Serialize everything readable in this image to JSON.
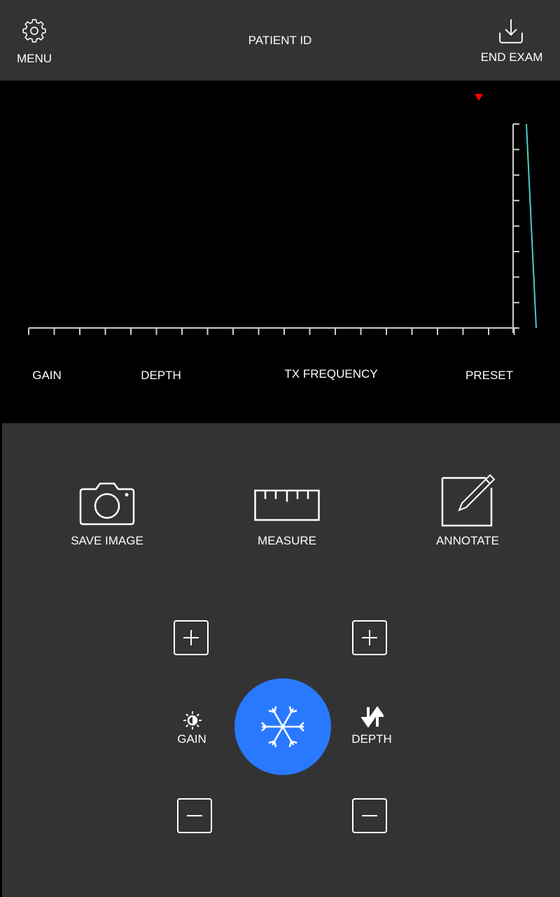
{
  "header": {
    "menu_label": "MENU",
    "patient_id": "PATIENT ID",
    "end_exam_label": "END EXAM"
  },
  "image_area": {
    "labels": {
      "gain": "GAIN",
      "depth": "DEPTH",
      "tx_frequency": "TX FREQUENCY",
      "preset": "PRESET"
    },
    "marker_color": "#ff0000",
    "trace_color": "#4ecdc4"
  },
  "actions": {
    "save_image": "SAVE IMAGE",
    "measure": "MEASURE",
    "annotate": "ANNOTATE"
  },
  "controls": {
    "gain_label": "GAIN",
    "depth_label": "DEPTH",
    "freeze_color": "#2979ff"
  }
}
